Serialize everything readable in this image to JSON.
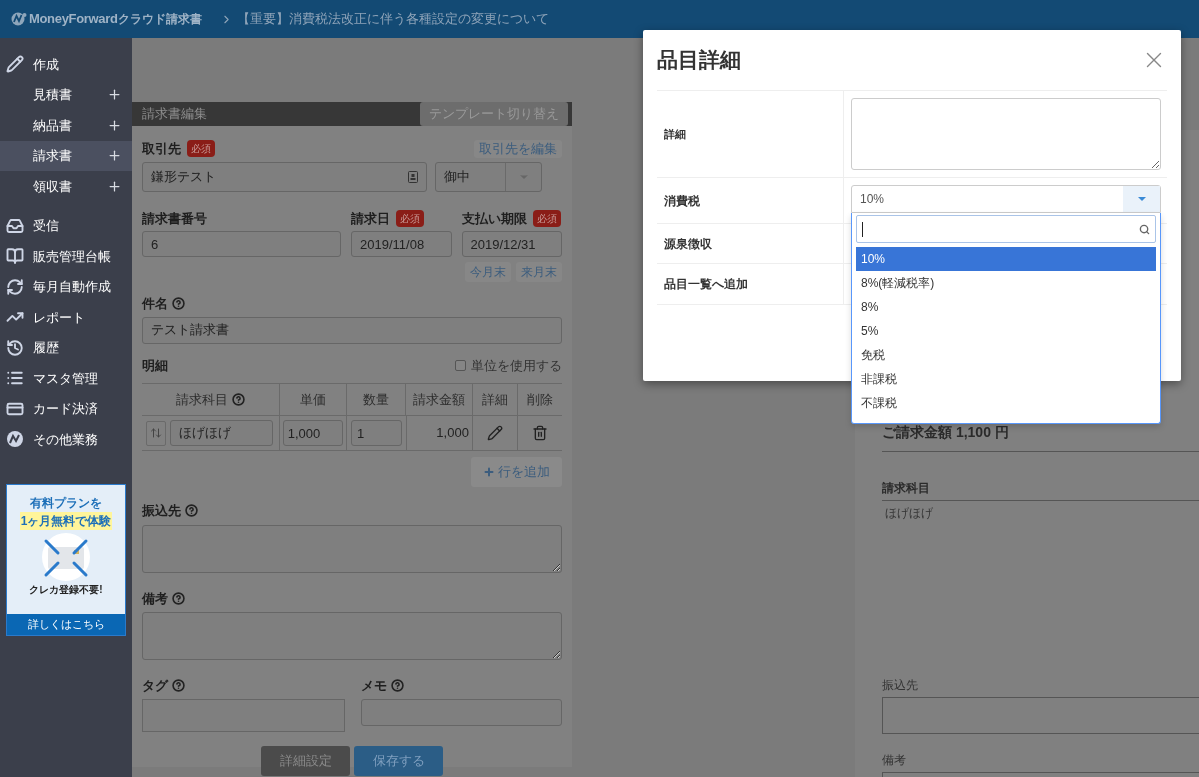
{
  "header": {
    "brand": "MoneyForward",
    "product": "クラウド請求書",
    "notice": "【重要】消費税法改正に伴う各種設定の変更について"
  },
  "sidebar": {
    "items": [
      {
        "kind": "section",
        "label": "作成"
      },
      {
        "kind": "sub",
        "label": "見積書",
        "selected": false
      },
      {
        "kind": "sub",
        "label": "納品書",
        "selected": false
      },
      {
        "kind": "sub",
        "label": "請求書",
        "selected": true
      },
      {
        "kind": "sub",
        "label": "領収書",
        "selected": false
      },
      {
        "kind": "section",
        "label": "受信"
      },
      {
        "kind": "section",
        "label": "販売管理台帳"
      },
      {
        "kind": "section",
        "label": "毎月自動作成"
      },
      {
        "kind": "section",
        "label": "レポート"
      },
      {
        "kind": "section",
        "label": "履歴"
      },
      {
        "kind": "section",
        "label": "マスタ管理"
      },
      {
        "kind": "section",
        "label": "カード決済"
      },
      {
        "kind": "section",
        "label": "その他業務"
      }
    ],
    "banner": {
      "line_1": "有料プランを",
      "line_2": "1ヶ月無料で体験",
      "caption": "クレカ登録不要!",
      "link": "詳しくはこちら"
    }
  },
  "form": {
    "title": "請求書編集",
    "template_button": "テンプレート切り替え",
    "client": {
      "label": "取引先",
      "required": "必須",
      "edit_button": "取引先を編集",
      "value": "鎌形テスト",
      "honorific": "御中"
    },
    "number": {
      "label": "請求書番号",
      "value": "6"
    },
    "date": {
      "label": "請求日",
      "required": "必須",
      "value": "2019/11/08"
    },
    "due": {
      "label": "支払い期限",
      "required": "必須",
      "value": "2019/12/31"
    },
    "due_buttons": [
      "今月末",
      "来月末"
    ],
    "subject": {
      "label": "件名",
      "value": "テスト請求書"
    },
    "details": {
      "label": "明細",
      "unit_checkbox": {
        "label": "単位を使用する",
        "checked": false
      },
      "columns": [
        "請求科目",
        "単価",
        "数量",
        "請求金額",
        "詳細",
        "削除"
      ],
      "rows": [
        {
          "item": "ほげほげ",
          "price": "1,000",
          "qty": "1",
          "amount": "1,000"
        }
      ],
      "add_button": "行を追加"
    },
    "bank": {
      "label": "振込先"
    },
    "remarks": {
      "label": "備考"
    },
    "tag": {
      "label": "タグ"
    },
    "memo": {
      "label": "メモ"
    },
    "buttons": [
      {
        "kind": "secondary",
        "label": "詳細設定"
      },
      {
        "kind": "primary",
        "label": "保存する"
      }
    ]
  },
  "preview": {
    "total": "ご請求金額 1,100 円",
    "items_heading": "請求科目",
    "item": "ほげほげ",
    "bank_label": "振込先",
    "remarks_label": "備考"
  },
  "modal": {
    "title": "品目詳細",
    "rows": [
      {
        "label": "詳細"
      },
      {
        "label": "消費税"
      },
      {
        "label": "源泉徴収"
      },
      {
        "label": "品目一覧へ追加"
      }
    ],
    "tax_value": "10%",
    "options": [
      {
        "label": "10%",
        "selected": true
      },
      {
        "label": "8%(軽減税率)",
        "selected": false
      },
      {
        "label": "8%",
        "selected": false
      },
      {
        "label": "5%",
        "selected": false
      },
      {
        "label": "免税",
        "selected": false
      },
      {
        "label": "非課税",
        "selected": false
      },
      {
        "label": "不課税",
        "selected": false
      }
    ]
  }
}
